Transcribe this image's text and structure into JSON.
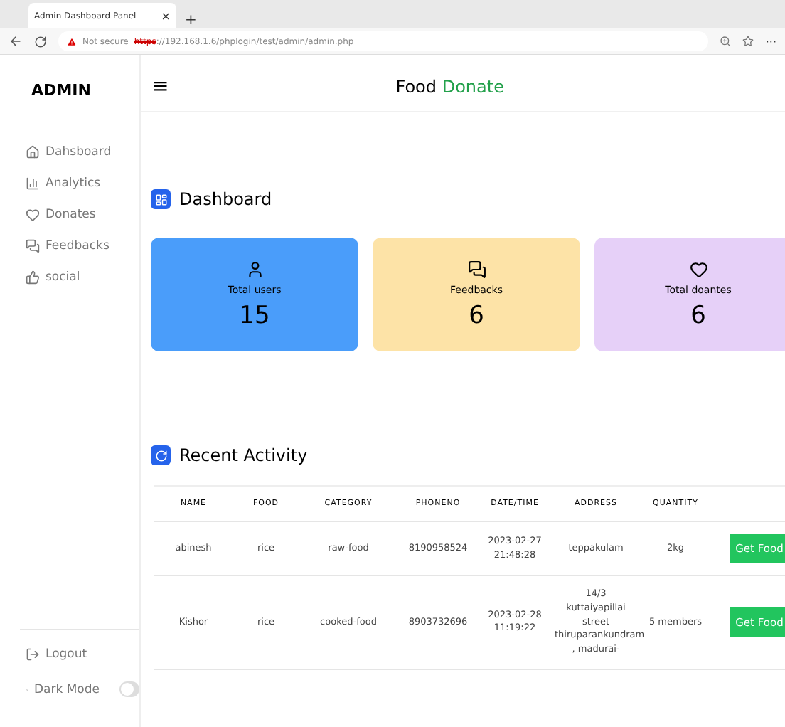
{
  "browser": {
    "tab_title": "Admin Dashboard Panel",
    "tab_close": "×",
    "new_tab": "+",
    "security": "Not secure",
    "url_scheme": "https",
    "url_rest": "://192.168.1.6/phplogin/test/admin/admin.php",
    "more": "···"
  },
  "sidebar": {
    "brand": "ADMIN",
    "items": [
      {
        "label": "Dahsboard"
      },
      {
        "label": "Analytics"
      },
      {
        "label": "Donates"
      },
      {
        "label": "Feedbacks"
      },
      {
        "label": "social"
      }
    ],
    "logout": "Logout",
    "dark_mode": {
      "label": "Dark Mode",
      "on": false
    }
  },
  "header": {
    "menu": "≡",
    "title": "Food",
    "title_accent": "Donate"
  },
  "dashboard": {
    "title": "Dashboard",
    "cards": [
      {
        "label": "Total users",
        "value": "15",
        "color": "#4a9dfa"
      },
      {
        "label": "Feedbacks",
        "value": "6",
        "color": "#fde3a7"
      },
      {
        "label": "Total doantes",
        "value": "6",
        "color": "#e6d0f8"
      }
    ]
  },
  "recent_activity": {
    "title": "Recent Activity",
    "table": {
      "columns": [
        "NAME",
        "FOOD",
        "CATEGORY",
        "PHONENO",
        "DATE/TIME",
        "ADDRESS",
        "QUANTITY"
      ],
      "rows": [
        {
          "cells": [
            "abinesh",
            "rice",
            "raw-food",
            "8190958524",
            "2023-02-27 21:48:28",
            "teppakulam",
            "2kg"
          ],
          "action": "Get Food"
        },
        {
          "cells": [
            "Kishor",
            "rice",
            "cooked-food",
            "8903732696",
            "2023-02-28 11:19:22",
            "14/3 kuttaiyapillai street thiruparankundram , madurai-",
            "5 members"
          ],
          "action": "Get Food"
        }
      ]
    }
  }
}
